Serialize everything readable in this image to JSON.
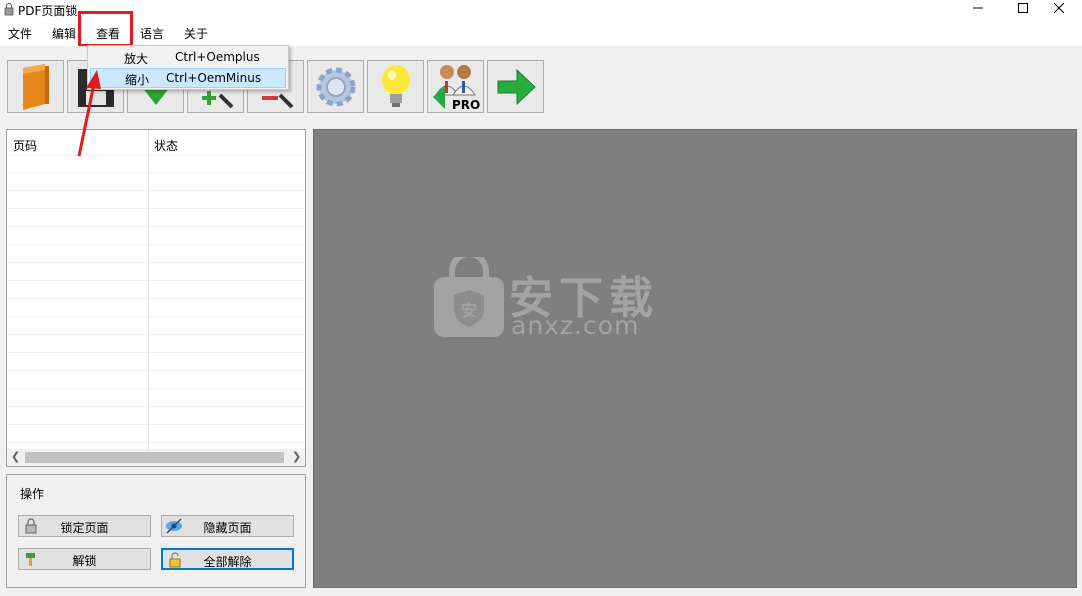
{
  "window": {
    "title": "PDF页面锁"
  },
  "menu": {
    "file": "文件",
    "edit": "编辑",
    "view": "查看",
    "language": "语言",
    "about": "关于"
  },
  "view_menu": {
    "items": [
      {
        "label": "放大",
        "shortcut": "Ctrl+Oemplus"
      },
      {
        "label": "缩小",
        "shortcut": "Ctrl+OemMinus"
      }
    ],
    "selected_index": 1
  },
  "toolbar": {
    "buttons": [
      "open-folder-icon",
      "save-disk-icon",
      "download-arrow-icon",
      "zoom-in-icon",
      "zoom-out-icon",
      "settings-gear-icon",
      "idea-bulb-icon",
      "pro-users-icon",
      "next-arrow-icon"
    ]
  },
  "page_list": {
    "columns": [
      "页码",
      "状态"
    ],
    "rows": []
  },
  "operations": {
    "title": "操作",
    "lock_page": "锁定页面",
    "hide_page": "隐藏页面",
    "unlock": "解锁",
    "remove_all": "全部解除"
  },
  "watermark": {
    "main": "安下载",
    "sub": "anxz.com"
  },
  "colors": {
    "highlight_red": "#e01b1b",
    "menu_selection": "#cce8ff",
    "preview_bg": "#7f7f7f",
    "focus_blue": "#0078d7"
  }
}
